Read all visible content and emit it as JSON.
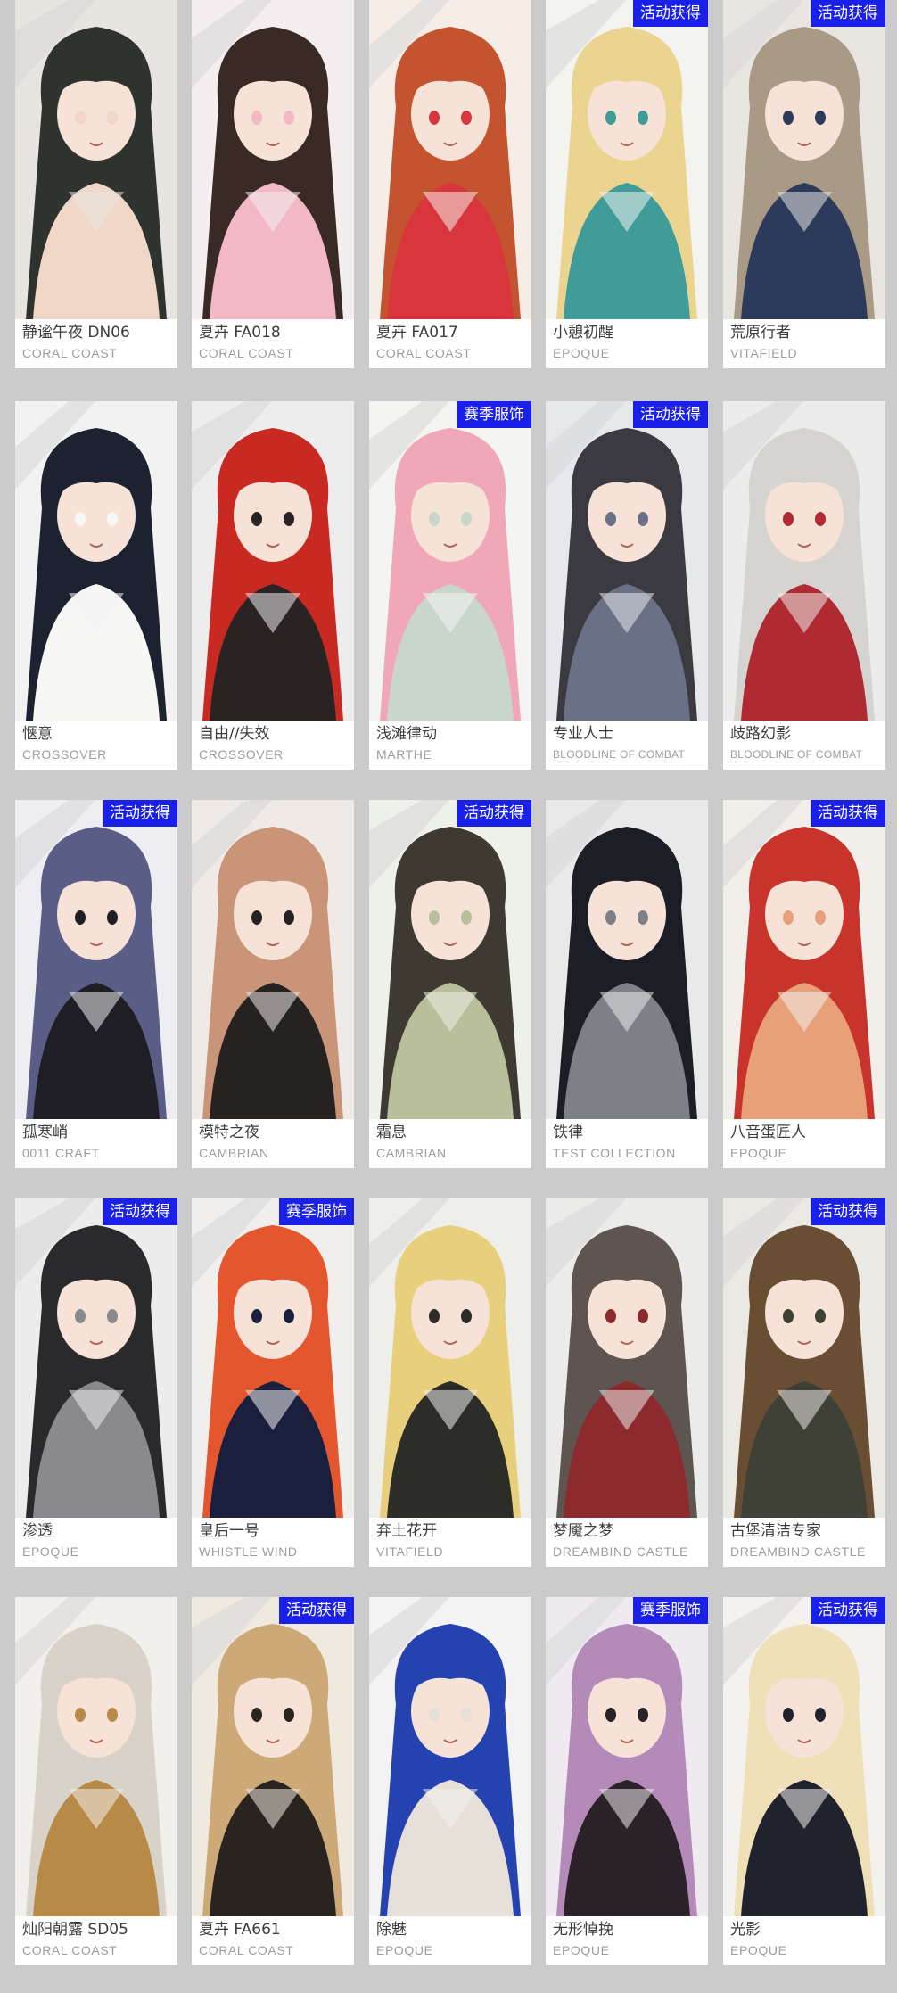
{
  "cards": [
    {
      "name": "静谧午夜 DN06",
      "brand": "CORAL COAST",
      "tag": "",
      "palette": [
        "#e8e4e0",
        "#2f3330",
        "#f0d7c8"
      ]
    },
    {
      "name": "夏卉 FA018",
      "brand": "CORAL COAST",
      "tag": "",
      "palette": [
        "#f4eef0",
        "#3a2a26",
        "#f2b8c6"
      ]
    },
    {
      "name": "夏卉 FA017",
      "brand": "CORAL COAST",
      "tag": "",
      "palette": [
        "#f6ede6",
        "#c4532f",
        "#d8363c"
      ]
    },
    {
      "name": "小憩初醒",
      "brand": "EPOQUE",
      "tag": "活动获得",
      "palette": [
        "#f3f3f0",
        "#ead48f",
        "#3f9c98"
      ]
    },
    {
      "name": "荒原行者",
      "brand": "VITAFIELD",
      "tag": "活动获得",
      "palette": [
        "#e9e6e2",
        "#a99a85",
        "#2c3a5c"
      ]
    },
    {
      "name": "惬意",
      "brand": "CROSSOVER",
      "tag": "",
      "palette": [
        "#f2f2f2",
        "#1c2230",
        "#f7f7f5"
      ]
    },
    {
      "name": "自由//失效",
      "brand": "CROSSOVER",
      "tag": "",
      "palette": [
        "#ededed",
        "#c82a22",
        "#2a2324"
      ]
    },
    {
      "name": "浅滩律动",
      "brand": "MARTHE",
      "tag": "赛季服饰",
      "palette": [
        "#f4f4f2",
        "#f0a8b8",
        "#c8d6cc"
      ]
    },
    {
      "name": "专业人士",
      "brand": "BLOODLINE OF COMBAT",
      "tag": "活动获得",
      "palette": [
        "#e6e8ec",
        "#3a3a40",
        "#6a7086"
      ]
    },
    {
      "name": "歧路幻影",
      "brand": "BLOODLINE OF COMBAT",
      "tag": "",
      "palette": [
        "#ececec",
        "#d6d4d0",
        "#b02a32"
      ]
    },
    {
      "name": "孤寒峭",
      "brand": "0011 CRAFT",
      "tag": "活动获得",
      "palette": [
        "#eeeef2",
        "#5a5e86",
        "#1e1e24"
      ]
    },
    {
      "name": "模特之夜",
      "brand": "CAMBRIAN",
      "tag": "",
      "palette": [
        "#efeae6",
        "#c99478",
        "#262222"
      ]
    },
    {
      "name": "霜息",
      "brand": "CAMBRIAN",
      "tag": "活动获得",
      "palette": [
        "#eef0ea",
        "#3e3a32",
        "#b8bf9a"
      ]
    },
    {
      "name": "铁律",
      "brand": "TEST COLLECTION",
      "tag": "",
      "palette": [
        "#e9e9ea",
        "#1c1e26",
        "#7e8088"
      ]
    },
    {
      "name": "八音蛋匠人",
      "brand": "EPOQUE",
      "tag": "活动获得",
      "palette": [
        "#f2eeea",
        "#c8342c",
        "#e7a078"
      ]
    },
    {
      "name": "渗透",
      "brand": "EPOQUE",
      "tag": "活动获得",
      "palette": [
        "#ececec",
        "#2a2a2c",
        "#8a8a8e"
      ]
    },
    {
      "name": "皇后一号",
      "brand": "WHISTLE WIND",
      "tag": "赛季服饰",
      "palette": [
        "#f1eeee",
        "#e4562e",
        "#1a1f3e"
      ]
    },
    {
      "name": "弃土花开",
      "brand": "VITAFIELD",
      "tag": "",
      "palette": [
        "#eeeeea",
        "#e8cf7c",
        "#2c2c28"
      ]
    },
    {
      "name": "梦魇之梦",
      "brand": "DREAMBIND CASTLE",
      "tag": "",
      "palette": [
        "#ebebea",
        "#5e5450",
        "#8c2a2e"
      ]
    },
    {
      "name": "古堡清洁专家",
      "brand": "DREAMBIND CASTLE",
      "tag": "活动获得",
      "palette": [
        "#ebe9e4",
        "#6a4e34",
        "#3f4036"
      ]
    },
    {
      "name": "灿阳朝露 SD05",
      "brand": "CORAL COAST",
      "tag": "",
      "palette": [
        "#f2f0ec",
        "#d8d2c8",
        "#b88a48"
      ]
    },
    {
      "name": "夏卉 FA661",
      "brand": "CORAL COAST",
      "tag": "活动获得",
      "palette": [
        "#efe9e0",
        "#cda978",
        "#2a2420"
      ]
    },
    {
      "name": "除魅",
      "brand": "EPOQUE",
      "tag": "",
      "palette": [
        "#f3f3f3",
        "#2442b0",
        "#e7e0d8"
      ]
    },
    {
      "name": "无形悼挽",
      "brand": "EPOQUE",
      "tag": "赛季服饰",
      "palette": [
        "#eeeaf0",
        "#b48ab8",
        "#2a2228"
      ]
    },
    {
      "name": "光影",
      "brand": "EPOQUE",
      "tag": "活动获得",
      "palette": [
        "#f4f2ee",
        "#efe0b8",
        "#20222e"
      ]
    }
  ]
}
